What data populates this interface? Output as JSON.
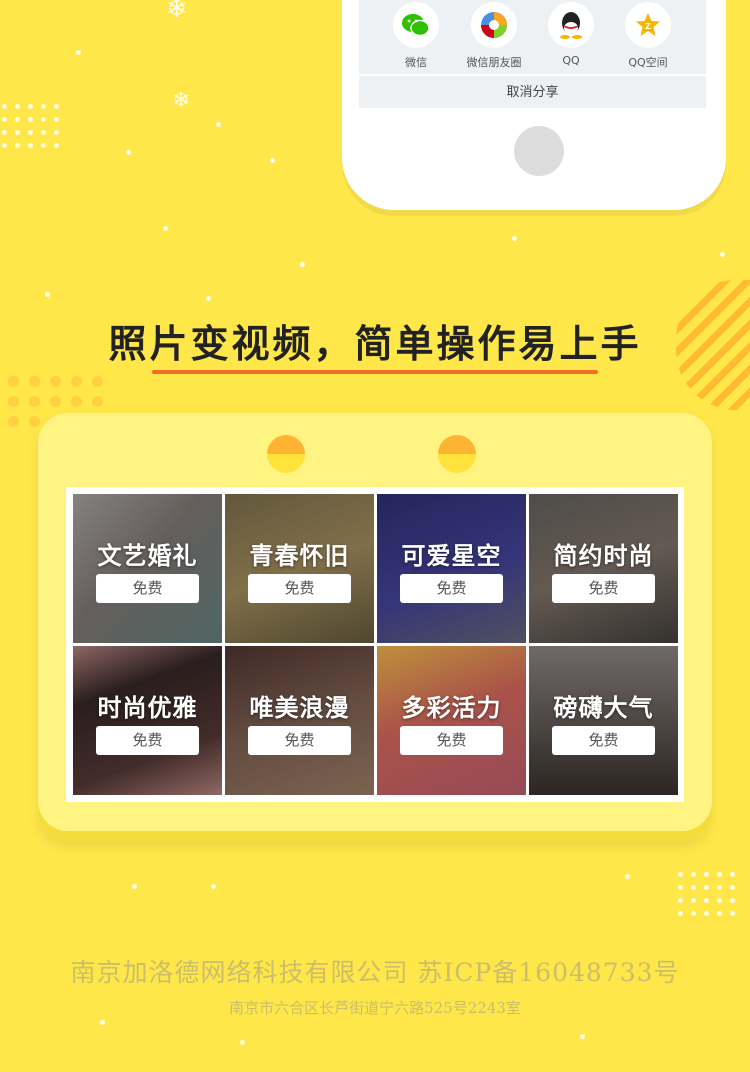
{
  "share_sheet": {
    "items": [
      {
        "label": "微信",
        "icon": "wechat-icon",
        "color": "#2dc100"
      },
      {
        "label": "微信朋友圈",
        "icon": "wechat-moments-icon",
        "color": "#f5a623"
      },
      {
        "label": "QQ",
        "icon": "qq-icon",
        "color": "#222222"
      },
      {
        "label": "QQ空间",
        "icon": "qzone-icon",
        "color": "#f7b500"
      }
    ],
    "cancel_label": "取消分享"
  },
  "heading": {
    "title": "照片变视频，简单操作易上手"
  },
  "templates": [
    {
      "title": "文艺婚礼",
      "button": "免费"
    },
    {
      "title": "青春怀旧",
      "button": "免费"
    },
    {
      "title": "可爱星空",
      "button": "免费"
    },
    {
      "title": "简约时尚",
      "button": "免费"
    },
    {
      "title": "时尚优雅",
      "button": "免费"
    },
    {
      "title": "唯美浪漫",
      "button": "免费"
    },
    {
      "title": "多彩活力",
      "button": "免费"
    },
    {
      "title": "磅礴大气",
      "button": "免费"
    }
  ],
  "footer": {
    "company": "南京加洛德网络科技有限公司 苏ICP备16048733号",
    "address": "南京市六合区长芦街道宁六路525号2243室"
  },
  "colors": {
    "background": "#ffe74a",
    "accent_underline": "#f06f2a",
    "board": "#fff382"
  }
}
